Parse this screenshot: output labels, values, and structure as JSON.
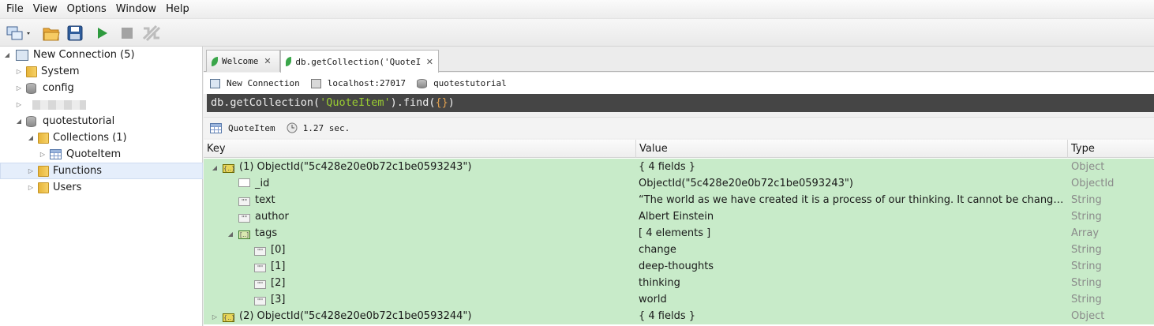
{
  "menu": [
    "File",
    "View",
    "Options",
    "Window",
    "Help"
  ],
  "sidebar": {
    "connection": "New Connection (5)",
    "databases": [
      {
        "label": "System"
      },
      {
        "label": "config"
      },
      {
        "label": ""
      },
      {
        "label": "quotestutorial"
      }
    ],
    "collections_folder": "Collections (1)",
    "collection_item": "QuoteItem",
    "functions": "Functions",
    "users": "Users"
  },
  "tabs": [
    {
      "label": "Welcome",
      "close": "✕"
    },
    {
      "label": "db.getCollection('QuoteIt…",
      "close": "✕"
    }
  ],
  "conn": {
    "connection": "New Connection",
    "host": "localhost:27017",
    "database": "quotestutorial"
  },
  "query": {
    "prefix": "db.getCollection(",
    "collection": "'QuoteItem'",
    "middle": ").find(",
    "args": "{}",
    "suffix": ")"
  },
  "result": {
    "collection": "QuoteItem",
    "time": "1.27 sec."
  },
  "grid": {
    "columns": [
      "Key",
      "Value",
      "Type"
    ],
    "rows": [
      {
        "key": "(1) ObjectId(\"5c428e20e0b72c1be0593243\")",
        "value": "{ 4 fields }",
        "type": "Object"
      },
      {
        "key": "_id",
        "value": "ObjectId(\"5c428e20e0b72c1be0593243\")",
        "type": "ObjectId"
      },
      {
        "key": "text",
        "value": "“The world as we have created it is a process of our thinking. It cannot be changed witho...",
        "type": "String"
      },
      {
        "key": "author",
        "value": "Albert Einstein",
        "type": "String"
      },
      {
        "key": "tags",
        "value": "[ 4 elements ]",
        "type": "Array"
      },
      {
        "key": "[0]",
        "value": "change",
        "type": "String"
      },
      {
        "key": "[1]",
        "value": "deep-thoughts",
        "type": "String"
      },
      {
        "key": "[2]",
        "value": "thinking",
        "type": "String"
      },
      {
        "key": "[3]",
        "value": "world",
        "type": "String"
      },
      {
        "key": "(2) ObjectId(\"5c428e20e0b72c1be0593244\")",
        "value": "{ 4 fields }",
        "type": "Object"
      }
    ]
  },
  "icon_labels": {
    "string": "\"\"",
    "object": "{..}",
    "array": "[..]"
  }
}
